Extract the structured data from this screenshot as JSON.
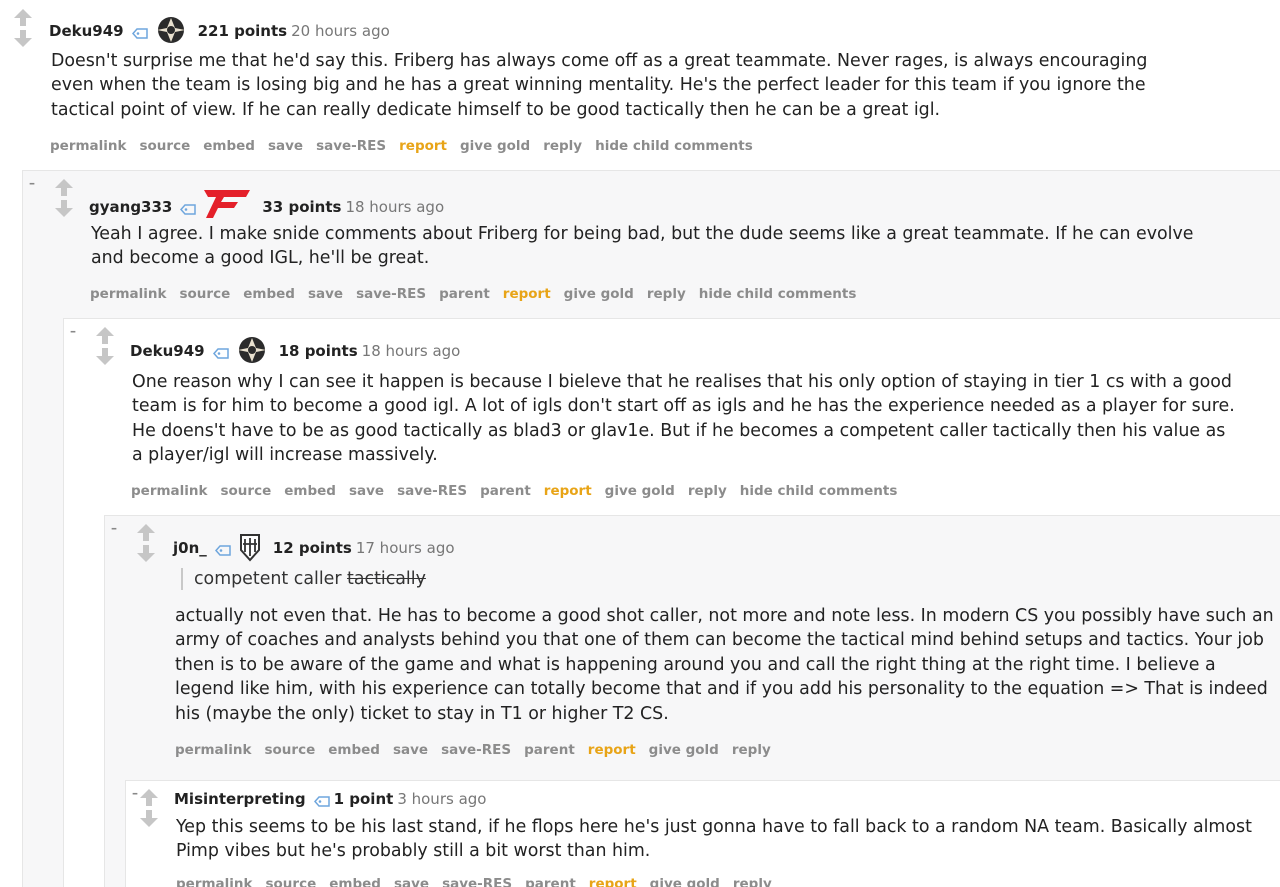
{
  "comments": [
    {
      "author": "Deku949",
      "score": "221 points",
      "time": "20 hours ago",
      "paragraphs": [
        "Doesn't surprise me that he'd say this. Friberg has always come off as a great teammate. Never rages, is always encouraging even when the team is losing big and he has a great winning mentality. He's the perfect leader for this team if you ignore the tactical point of view. If he can really dedicate himself to be good tactically then he can be a great igl."
      ],
      "buttons": [
        "permalink",
        "source",
        "embed",
        "save",
        "save-RES",
        "report",
        "give gold",
        "reply",
        "hide child comments"
      ]
    },
    {
      "collapse": "–",
      "author": "gyang333",
      "score": "33 points",
      "time": "18 hours ago",
      "paragraphs": [
        "Yeah I agree. I make snide comments about Friberg for being bad, but the dude seems like a great teammate. If he can evolve and become a good IGL, he'll be great."
      ],
      "buttons": [
        "permalink",
        "source",
        "embed",
        "save",
        "save-RES",
        "parent",
        "report",
        "give gold",
        "reply",
        "hide child comments"
      ]
    },
    {
      "collapse": "–",
      "author": "Deku949",
      "score": "18 points",
      "time": "18 hours ago",
      "paragraphs": [
        "One reason why I can see it happen is because I bieleve that he realises that his only option of staying in tier 1 cs with a good team is for him to become a good igl. A lot of igls don't start off as igls and he has the experience needed as a player for sure. He doens't have to be as good tactically as blad3 or glav1e. But if he becomes a competent caller tactically then his value as a player/igl will increase massively."
      ],
      "buttons": [
        "permalink",
        "source",
        "embed",
        "save",
        "save-RES",
        "parent",
        "report",
        "give gold",
        "reply",
        "hide child comments"
      ]
    },
    {
      "collapse": "–",
      "author": "j0n_",
      "score": "12 points",
      "time": "17 hours ago",
      "quote_plain": "competent caller ",
      "quote_struck": "tactically",
      "paragraphs": [
        "actually not even that. He has to become a good shot caller, not more and note less. In modern CS you possibly have such an army of coaches and analysts behind you that one of them can become the tactical mind behind setups and tactics. Your job then is to be aware of the game and what is happening around you and call the right thing at the right time. I believe a legend like him, with his experience can totally become that and if you add his personality to the equation => That is indeed his (maybe the only) ticket to stay in T1 or higher T2 CS."
      ],
      "buttons": [
        "permalink",
        "source",
        "embed",
        "save",
        "save-RES",
        "parent",
        "report",
        "give gold",
        "reply"
      ]
    },
    {
      "collapse": "–",
      "author": "Misinterpreting",
      "score": "1 point",
      "time": "3 hours ago",
      "paragraphs": [
        "Yep this seems to be his last stand, if he flops here he's just gonna have to fall back to a random NA team. Basically almost Pimp vibes but he's probably still a bit worst than him."
      ],
      "buttons": [
        "permalink",
        "source",
        "embed",
        "save",
        "save-RES",
        "parent",
        "report",
        "give gold",
        "reply"
      ]
    }
  ],
  "colors": {
    "report": "#e8a417",
    "button_gray": "#8c8c8c",
    "nested_gray": "#f7f7f8"
  },
  "icons": [
    "upvote-arrow-icon",
    "downvote-arrow-icon",
    "user-tag-icon",
    "ninjas-in-pyjamas-flair-icon",
    "faze-clan-flair-icon",
    "team-flair-icon"
  ]
}
